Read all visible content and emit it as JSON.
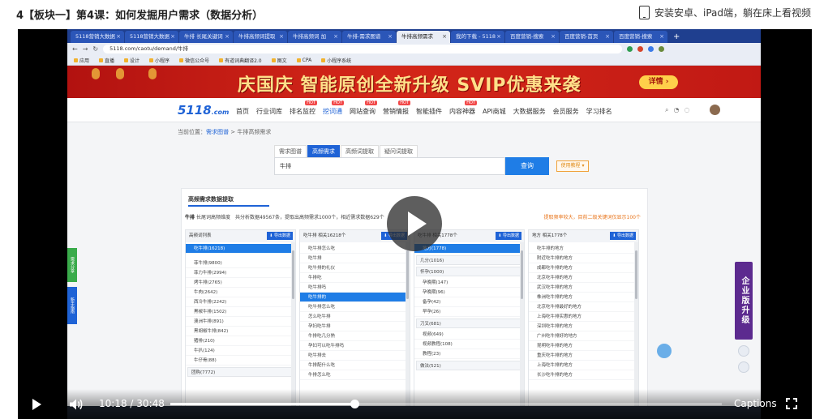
{
  "header": {
    "course_title": "4【板块一】第4课：如何发掘用户需求（数据分析）",
    "install_label": "安装安卓、iPad端，躺在床上看视频"
  },
  "browser": {
    "tabs": [
      "5118营销大数据",
      "5118营销大数据",
      "牛排 长尾关键词",
      "牛排高频词提取",
      "牛排高频词 加",
      "牛排-需求图谱",
      "牛排高频需求",
      "我的下载 - 5118",
      "百度营销-搜索",
      "百度营销-首页",
      "百度营销-搜索"
    ],
    "url": "5118.com/caotu/demand/牛排",
    "bookmarks": [
      "应用",
      "直播",
      "设计",
      "小程序",
      "微信公众号",
      "有道词典翻译2.0",
      "图文",
      "CPA",
      "小程序系统"
    ]
  },
  "banner": {
    "text": "庆国庆 智能原创全新升级 SVIP优惠来袭",
    "button": "详情 ›"
  },
  "site": {
    "logo": "5118",
    "logo_suffix": ".com",
    "nav": [
      "首页",
      "行业词库",
      "排名监控",
      "挖词通",
      "网站查询",
      "营销情报",
      "智能插件",
      "内容神器",
      "API商城",
      "大数据服务",
      "会员服务",
      "学习排名"
    ],
    "hot_badge": "HOT"
  },
  "page": {
    "breadcrumb_prefix": "当前位置：",
    "breadcrumb_link": "需求图谱",
    "breadcrumb_current": "> 牛排高频需求",
    "search_tabs": [
      "需求图谱",
      "高频需求",
      "高频词提取",
      "疑问词提取"
    ],
    "search_value": "牛排",
    "search_button": "查询",
    "help_button": "使用教程 ▾"
  },
  "panel": {
    "title": "高频需求数据提取",
    "info_keyword": "牛排",
    "info_text": "长尾词高频维度　共分析数据49567条，提取出高频需求1000个，相近需求数据629个",
    "note": "提取频率较大，目前二级关键词仅显示100个",
    "columns": [
      {
        "head": "高频词列表",
        "items": [
          "吃牛排(16218)",
          "菲牛排(9800)",
          "菲力牛排(2994)",
          "烤牛排(2765)",
          "牛肉(2642)",
          "西冷牛排(2242)",
          "黑椒牛排(1502)",
          "澳洲牛排(891)",
          "黑胡椒牛排(842)",
          "猪排(210)",
          "牛扒(124)",
          "牛仔骨(88)",
          "团购(7772)"
        ]
      },
      {
        "head": "吃牛排 相关16218个",
        "items": [
          "吃牛排怎么吃",
          "吃牛排",
          "吃牛排的礼仪",
          "牛排吃",
          "吃牛排吗",
          "吃牛排的",
          "吃牛排怎么吃",
          "怎么吃牛排",
          "孕妇吃牛排",
          "牛排吃几分熟",
          "孕妇可以吃牛排吗",
          "吃牛排去",
          "牛排配什么吃",
          "牛排怎么吃"
        ]
      },
      {
        "head": "吃牛排 相关1778个",
        "items": [
          "地方(1778)",
          "几分(1016)",
          "怀孕(1000)",
          "孕晚期(147)",
          "孕晚期(96)",
          "备孕(42)",
          "早孕(26)",
          "刀叉(681)",
          "视频(649)",
          "视频教程(108)",
          "教程(23)",
          "做法(521)"
        ]
      },
      {
        "head": "地方 相关1778个",
        "items": [
          "吃牛排的地方",
          "附近吃牛排的地方",
          "成都吃牛排的地方",
          "北京吃牛排的地方",
          "武汉吃牛排的地方",
          "株洲吃牛排的地方",
          "北京吃牛排最好的地方",
          "上海吃牛排实惠的地方",
          "深圳吃牛排的地方",
          "广州吃牛排好的地方",
          "昆明吃牛排的地方",
          "重庆吃牛排的地方",
          "上海吃牛排的地方",
          "长沙吃牛排的地方"
        ]
      }
    ]
  },
  "side": {
    "left_widget_1": "需求分享",
    "left_widget_2": "新手指南",
    "right_widget": "企业版升级"
  },
  "player": {
    "time_current": "10:18",
    "time_separator": "/",
    "time_total": "30:48",
    "progress_fraction": 0.334,
    "captions_label": "Captions"
  },
  "colors": {
    "accent_blue": "#1f63d6",
    "banner_red": "#c11914",
    "banner_gold": "#ffe08a"
  },
  "icons": {
    "play": "play-icon",
    "volume": "volume-icon",
    "fullscreen": "fullscreen-icon",
    "tablet": "tablet-icon"
  }
}
